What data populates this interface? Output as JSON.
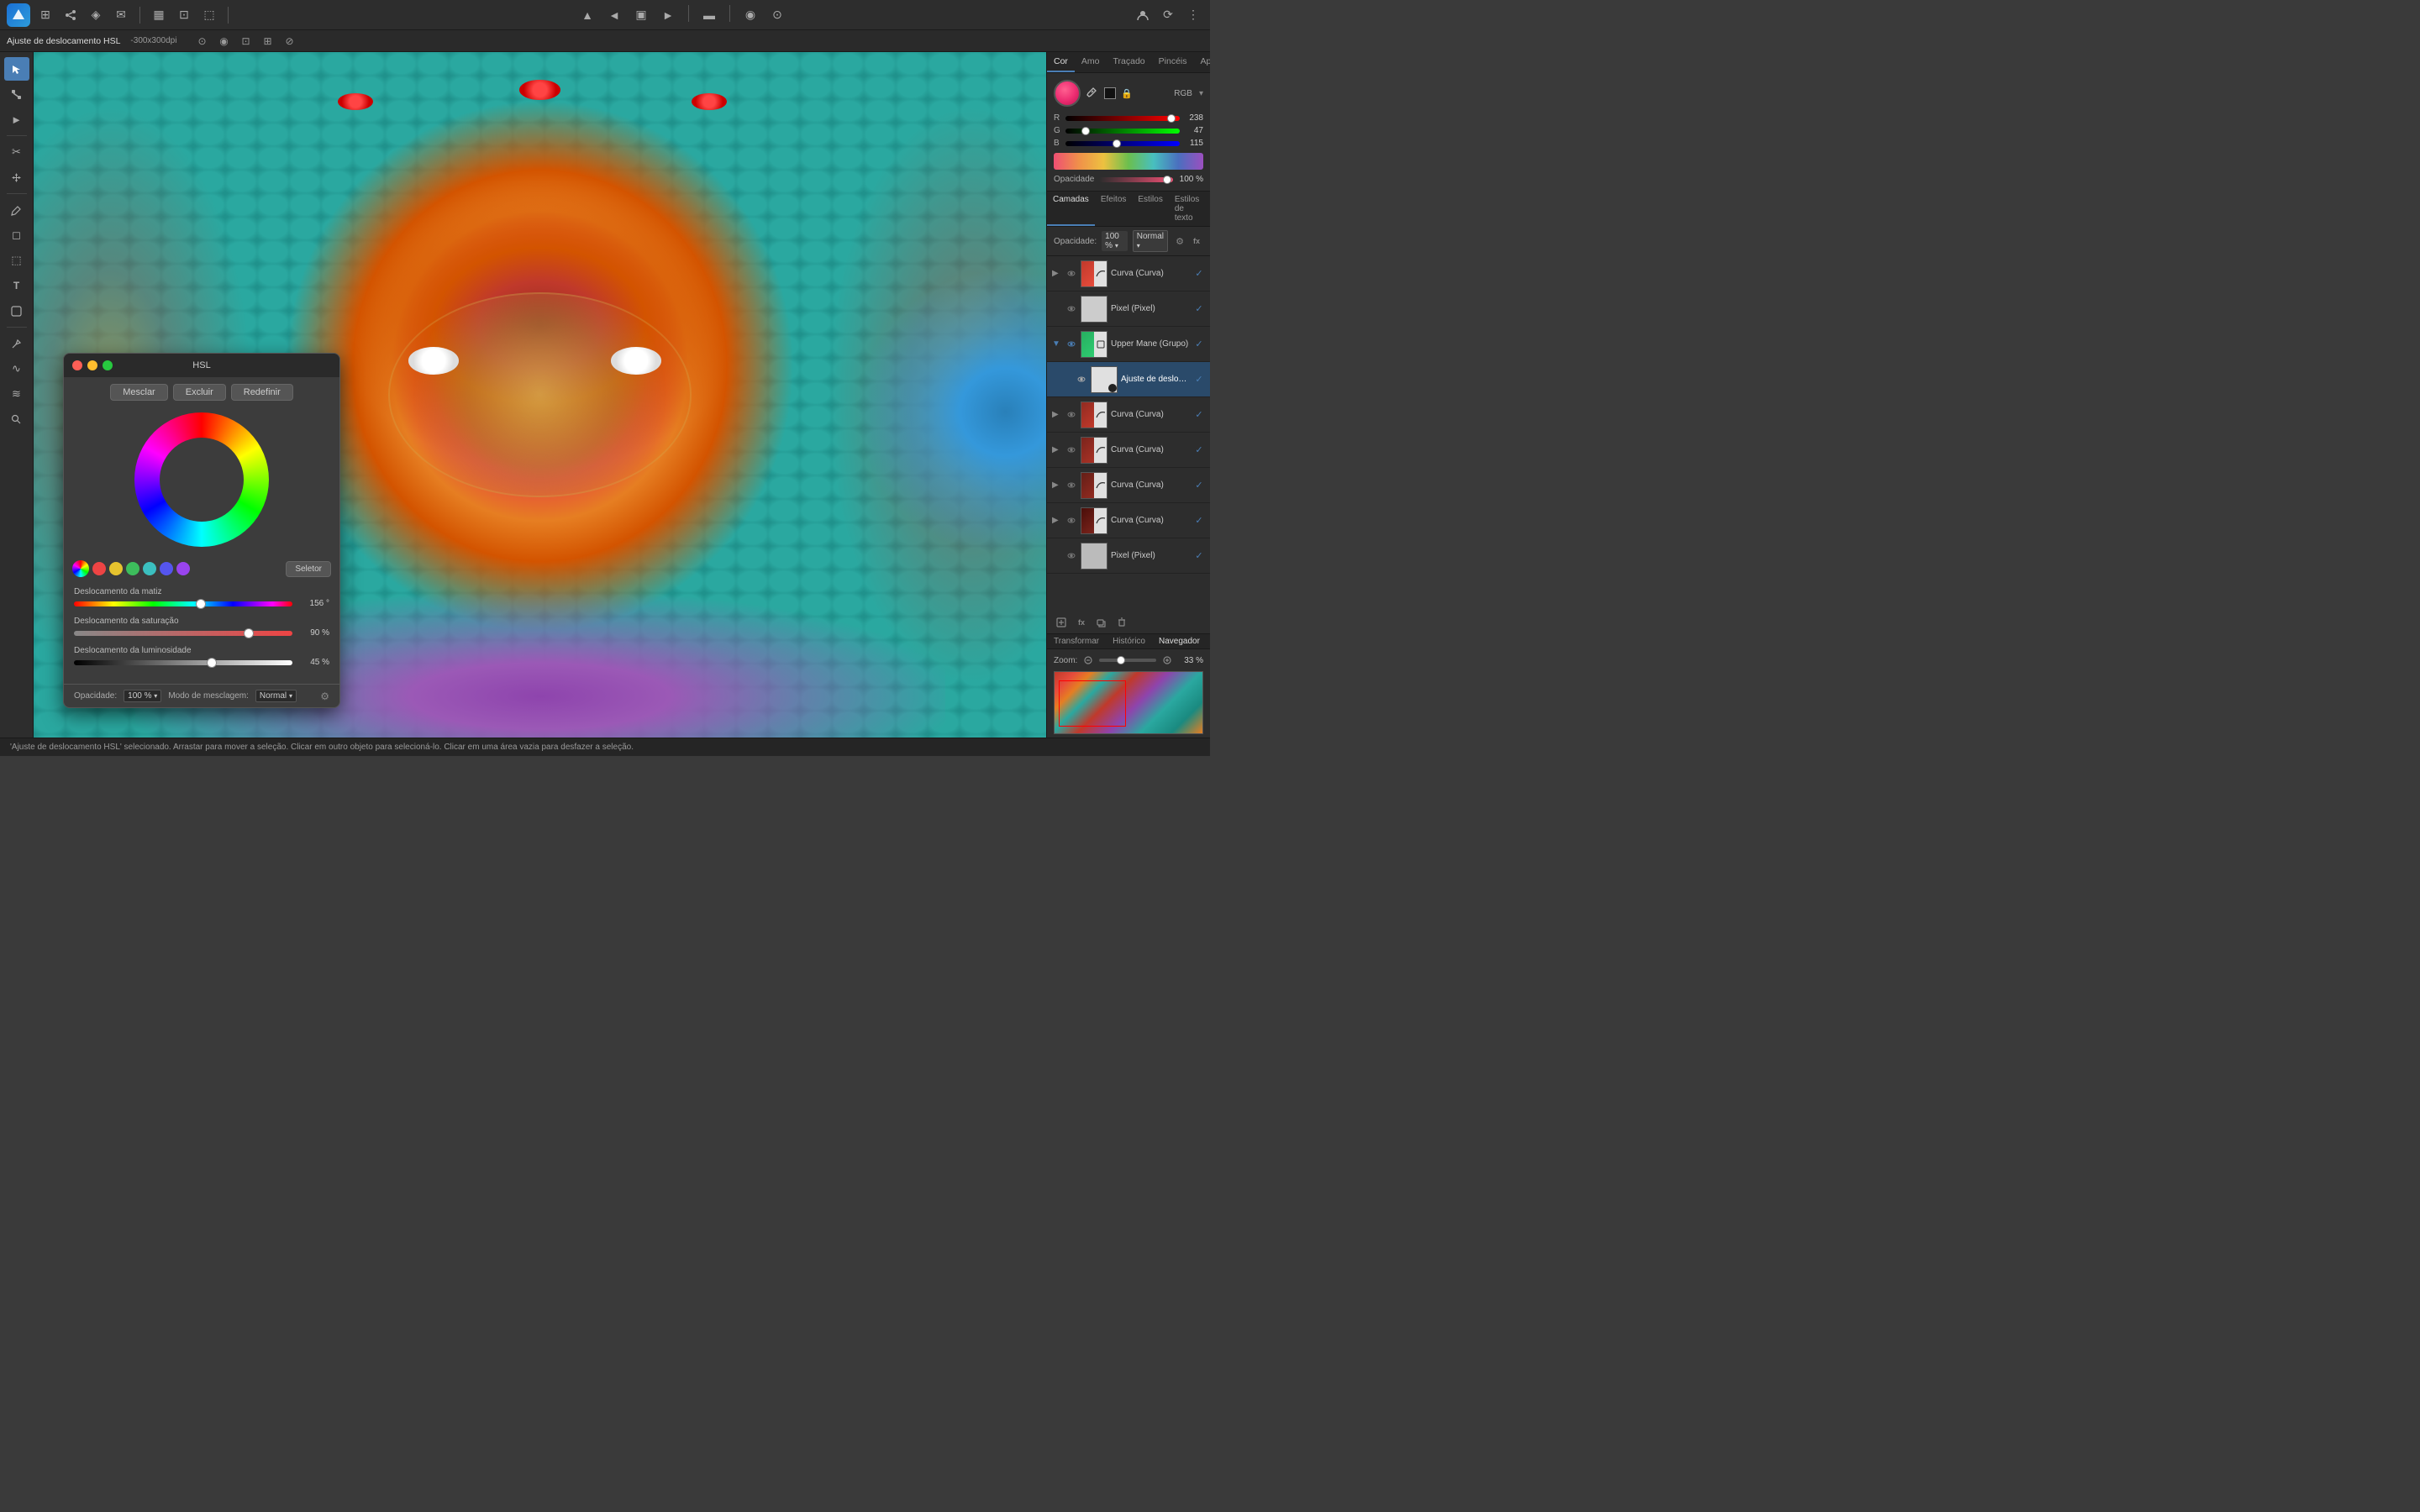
{
  "app": {
    "title": "Affinity Photo"
  },
  "docbar": {
    "title": "Ajuste de deslocamento HSL",
    "resolution": "-300x300dpi"
  },
  "topbar": {
    "icons": [
      "grid",
      "share",
      "⬡",
      "✉",
      "▦",
      "⊞",
      "⬛",
      "◈",
      "▲",
      "◄",
      "▣",
      "►",
      "▬",
      "◉",
      "⊙",
      "⬜",
      "⬛",
      "⊕",
      "⋮"
    ]
  },
  "tools": {
    "items": [
      "↖",
      "⊡",
      "►",
      "✏",
      "🖊",
      "▲",
      "∿",
      "✂",
      "⬚",
      "T",
      "🔲",
      "⊘",
      "≋",
      "∫",
      "☰",
      "⊕",
      "⌖",
      "↔",
      "✋",
      "⊙"
    ]
  },
  "right_panel": {
    "color_tabs": [
      "Cor",
      "Amo",
      "Traçado",
      "Pincéis",
      "Apa"
    ],
    "active_tab": "Cor",
    "rgb_mode": "RGB",
    "r_value": 238,
    "g_value": 47,
    "b_value": 115,
    "r_pct": 93,
    "g_pct": 18,
    "b_pct": 45,
    "opacity_label": "Opacidade",
    "opacity_value": "100 %"
  },
  "layers": {
    "tabs": [
      "Camadas",
      "Efeitos",
      "Estilos",
      "Estilos de texto"
    ],
    "active_tab": "Camadas",
    "opacity_label": "Opacidade:",
    "opacity_value": "100 %",
    "blend_mode": "Normal",
    "items": [
      {
        "name": "Curva (Curva)",
        "type": "curva",
        "checked": true,
        "visible": true,
        "expanded": false,
        "indent": 0
      },
      {
        "name": "Pixel (Pixel)",
        "type": "pixel",
        "checked": true,
        "visible": true,
        "expanded": false,
        "indent": 0
      },
      {
        "name": "Upper Mane (Grupo)",
        "type": "group",
        "checked": true,
        "visible": true,
        "expanded": false,
        "indent": 0
      },
      {
        "name": "Ajuste de deslocame",
        "type": "ajuste",
        "checked": true,
        "visible": true,
        "expanded": false,
        "indent": 1,
        "selected": true
      },
      {
        "name": "Curva (Curva)",
        "type": "curva2",
        "checked": true,
        "visible": true,
        "expanded": false,
        "indent": 0
      },
      {
        "name": "Curva (Curva)",
        "type": "curva3",
        "checked": true,
        "visible": true,
        "expanded": false,
        "indent": 0
      },
      {
        "name": "Curva (Curva)",
        "type": "curva4",
        "checked": true,
        "visible": true,
        "expanded": false,
        "indent": 0
      },
      {
        "name": "Curva (Curva)",
        "type": "curva5",
        "checked": true,
        "visible": true,
        "expanded": false,
        "indent": 0
      },
      {
        "name": "Pixel (Pixel)",
        "type": "pixel2",
        "checked": true,
        "visible": true,
        "expanded": false,
        "indent": 0
      }
    ]
  },
  "bottom_panel": {
    "tabs": [
      "Transformar",
      "Histórico",
      "Navegador"
    ],
    "active_tab": "Navegador",
    "zoom_label": "Zoom:",
    "zoom_value": "33 %"
  },
  "hsl_dialog": {
    "title": "HSL",
    "buttons": [
      "Mesclar",
      "Excluir",
      "Redefinir"
    ],
    "swatches": [
      {
        "color": "#ee4444",
        "label": "red"
      },
      {
        "color": "#e6c32e",
        "label": "yellow"
      },
      {
        "color": "#3dbd5c",
        "label": "green"
      },
      {
        "color": "#3bbfbf",
        "label": "teal"
      },
      {
        "color": "#5555ee",
        "label": "blue"
      },
      {
        "color": "#9944ee",
        "label": "purple"
      }
    ],
    "select_button": "Seletor",
    "hue_label": "Deslocamento da matiz",
    "hue_value": "156 °",
    "hue_pct": 58,
    "sat_label": "Deslocamento da saturação",
    "sat_value": "90 %",
    "sat_pct": 80,
    "lum_label": "Deslocamento da luminosidade",
    "lum_value": "45 %",
    "lum_pct": 63,
    "footer": {
      "opacity_label": "Opacidade:",
      "opacity_value": "100 %",
      "blend_label": "Modo de mesclagem:",
      "blend_value": "Normal"
    }
  },
  "statusbar": {
    "text": "'Ajuste de deslocamento HSL' selecionado. Arrastar para mover a seleção. Clicar em outro objeto para selecioná-lo. Clicar em uma área vazia para desfazer a seleção."
  },
  "blend_modes": {
    "normal_label_layers": "Normal",
    "normal_label_hsl": "Normal"
  }
}
